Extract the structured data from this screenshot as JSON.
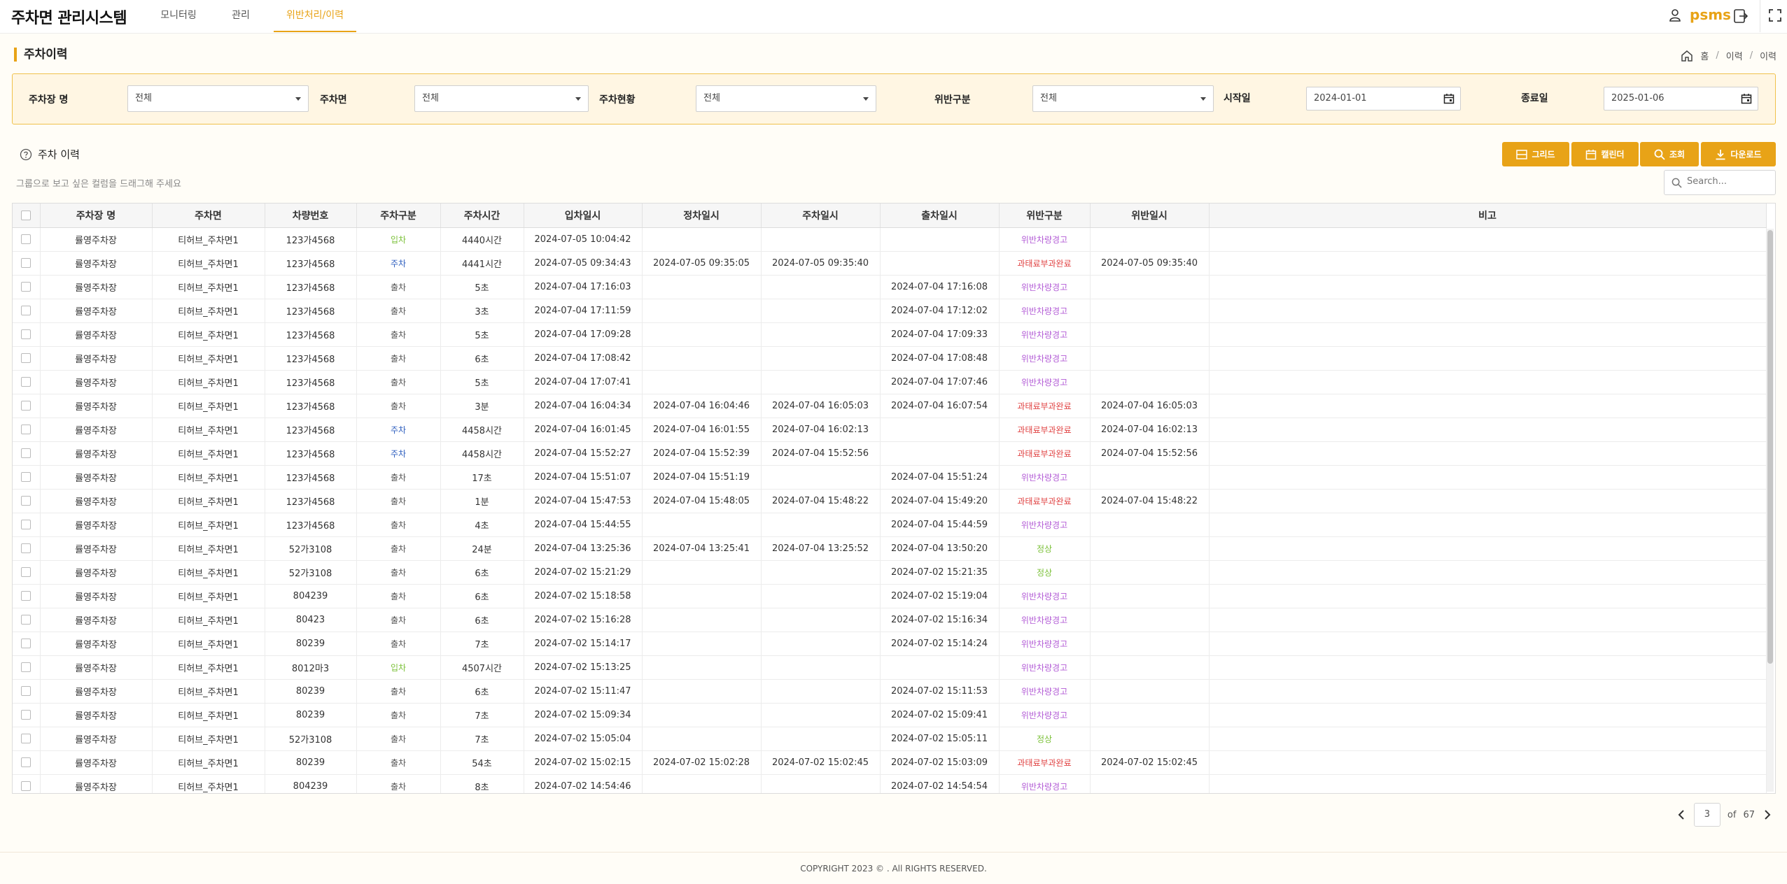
{
  "app": {
    "title": "주차면 관리시스템",
    "user": "psms"
  },
  "nav": {
    "tabs": [
      "모니터링",
      "관리",
      "위반처리/이력"
    ]
  },
  "page": {
    "title": "주차이력"
  },
  "breadcrumb": {
    "home": "홈",
    "level1": "이력",
    "level2": "이력"
  },
  "filters": {
    "lot_label": "주차장 명",
    "lot_value": "전체",
    "space_label": "주차면",
    "space_value": "전체",
    "status_label": "주차현황",
    "status_value": "전체",
    "violation_label": "위반구분",
    "violation_value": "전체",
    "start_label": "시작일",
    "start_value": "2024-01-01",
    "end_label": "종료일",
    "end_value": "2025-01-06"
  },
  "section": {
    "title": "주차 이력",
    "group_hint": "그룹으로 보고 싶은 컬럼을 드래그해 주세요"
  },
  "buttons": {
    "grid": "그리드",
    "calendar": "캘린더",
    "search": "조회",
    "download": "다운로드"
  },
  "search": {
    "placeholder": "Search..."
  },
  "colors": {
    "accent": "#e8a317",
    "entry": "#7cc13a",
    "parked": "#2f5fbf",
    "warning": "#b35cd6",
    "fine": "#e04141",
    "normal": "#7cc13a"
  },
  "table": {
    "columns": [
      "주차장 명",
      "주차면",
      "차량번호",
      "주차구분",
      "주차시간",
      "입차일시",
      "정차일시",
      "주차일시",
      "출차일시",
      "위반구분",
      "위반일시",
      "비고"
    ],
    "rows": [
      [
        "률영주차장",
        "티허브_주차면1",
        "123가4568",
        "입차",
        "4440시간",
        "2024-07-05 10:04:42",
        "",
        "",
        "",
        "위반차량경고",
        "",
        ""
      ],
      [
        "률영주차장",
        "티허브_주차면1",
        "123가4568",
        "주차",
        "4441시간",
        "2024-07-05 09:34:43",
        "2024-07-05 09:35:05",
        "2024-07-05 09:35:40",
        "",
        "과태료부과완료",
        "2024-07-05 09:35:40",
        ""
      ],
      [
        "률영주차장",
        "티허브_주차면1",
        "123가4568",
        "출차",
        "5초",
        "2024-07-04 17:16:03",
        "",
        "",
        "2024-07-04 17:16:08",
        "위반차량경고",
        "",
        ""
      ],
      [
        "률영주차장",
        "티허브_주차면1",
        "123가4568",
        "출차",
        "3초",
        "2024-07-04 17:11:59",
        "",
        "",
        "2024-07-04 17:12:02",
        "위반차량경고",
        "",
        ""
      ],
      [
        "률영주차장",
        "티허브_주차면1",
        "123가4568",
        "출차",
        "5초",
        "2024-07-04 17:09:28",
        "",
        "",
        "2024-07-04 17:09:33",
        "위반차량경고",
        "",
        ""
      ],
      [
        "률영주차장",
        "티허브_주차면1",
        "123가4568",
        "출차",
        "6초",
        "2024-07-04 17:08:42",
        "",
        "",
        "2024-07-04 17:08:48",
        "위반차량경고",
        "",
        ""
      ],
      [
        "률영주차장",
        "티허브_주차면1",
        "123가4568",
        "출차",
        "5초",
        "2024-07-04 17:07:41",
        "",
        "",
        "2024-07-04 17:07:46",
        "위반차량경고",
        "",
        ""
      ],
      [
        "률영주차장",
        "티허브_주차면1",
        "123가4568",
        "출차",
        "3분",
        "2024-07-04 16:04:34",
        "2024-07-04 16:04:46",
        "2024-07-04 16:05:03",
        "2024-07-04 16:07:54",
        "과태료부과완료",
        "2024-07-04 16:05:03",
        ""
      ],
      [
        "률영주차장",
        "티허브_주차면1",
        "123가4568",
        "주차",
        "4458시간",
        "2024-07-04 16:01:45",
        "2024-07-04 16:01:55",
        "2024-07-04 16:02:13",
        "",
        "과태료부과완료",
        "2024-07-04 16:02:13",
        ""
      ],
      [
        "률영주차장",
        "티허브_주차면1",
        "123가4568",
        "주차",
        "4458시간",
        "2024-07-04 15:52:27",
        "2024-07-04 15:52:39",
        "2024-07-04 15:52:56",
        "",
        "과태료부과완료",
        "2024-07-04 15:52:56",
        ""
      ],
      [
        "률영주차장",
        "티허브_주차면1",
        "123가4568",
        "출차",
        "17초",
        "2024-07-04 15:51:07",
        "2024-07-04 15:51:19",
        "",
        "2024-07-04 15:51:24",
        "위반차량경고",
        "",
        ""
      ],
      [
        "률영주차장",
        "티허브_주차면1",
        "123가4568",
        "출차",
        "1분",
        "2024-07-04 15:47:53",
        "2024-07-04 15:48:05",
        "2024-07-04 15:48:22",
        "2024-07-04 15:49:20",
        "과태료부과완료",
        "2024-07-04 15:48:22",
        ""
      ],
      [
        "률영주차장",
        "티허브_주차면1",
        "123가4568",
        "출차",
        "4초",
        "2024-07-04 15:44:55",
        "",
        "",
        "2024-07-04 15:44:59",
        "위반차량경고",
        "",
        ""
      ],
      [
        "률영주차장",
        "티허브_주차면1",
        "52가3108",
        "출차",
        "24분",
        "2024-07-04 13:25:36",
        "2024-07-04 13:25:41",
        "2024-07-04 13:25:52",
        "2024-07-04 13:50:20",
        "정상",
        "",
        ""
      ],
      [
        "률영주차장",
        "티허브_주차면1",
        "52가3108",
        "출차",
        "6초",
        "2024-07-02 15:21:29",
        "",
        "",
        "2024-07-02 15:21:35",
        "정상",
        "",
        ""
      ],
      [
        "률영주차장",
        "티허브_주차면1",
        "804239",
        "출차",
        "6초",
        "2024-07-02 15:18:58",
        "",
        "",
        "2024-07-02 15:19:04",
        "위반차량경고",
        "",
        ""
      ],
      [
        "률영주차장",
        "티허브_주차면1",
        "80423",
        "출차",
        "6초",
        "2024-07-02 15:16:28",
        "",
        "",
        "2024-07-02 15:16:34",
        "위반차량경고",
        "",
        ""
      ],
      [
        "률영주차장",
        "티허브_주차면1",
        "80239",
        "출차",
        "7초",
        "2024-07-02 15:14:17",
        "",
        "",
        "2024-07-02 15:14:24",
        "위반차량경고",
        "",
        ""
      ],
      [
        "률영주차장",
        "티허브_주차면1",
        "8012마3",
        "입차",
        "4507시간",
        "2024-07-02 15:13:25",
        "",
        "",
        "",
        "위반차량경고",
        "",
        ""
      ],
      [
        "률영주차장",
        "티허브_주차면1",
        "80239",
        "출차",
        "6초",
        "2024-07-02 15:11:47",
        "",
        "",
        "2024-07-02 15:11:53",
        "위반차량경고",
        "",
        ""
      ],
      [
        "률영주차장",
        "티허브_주차면1",
        "80239",
        "출차",
        "7초",
        "2024-07-02 15:09:34",
        "",
        "",
        "2024-07-02 15:09:41",
        "위반차량경고",
        "",
        ""
      ],
      [
        "률영주차장",
        "티허브_주차면1",
        "52가3108",
        "출차",
        "7초",
        "2024-07-02 15:05:04",
        "",
        "",
        "2024-07-02 15:05:11",
        "정상",
        "",
        ""
      ],
      [
        "률영주차장",
        "티허브_주차면1",
        "80239",
        "출차",
        "54초",
        "2024-07-02 15:02:15",
        "2024-07-02 15:02:28",
        "2024-07-02 15:02:45",
        "2024-07-02 15:03:09",
        "과태료부과완료",
        "2024-07-02 15:02:45",
        ""
      ],
      [
        "률영주차장",
        "티허브_주차면1",
        "804239",
        "출차",
        "8초",
        "2024-07-02 14:54:46",
        "",
        "",
        "2024-07-02 14:54:54",
        "위반차량경고",
        "",
        ""
      ]
    ]
  },
  "pagination": {
    "current": "3",
    "of_label": "of",
    "total": "67"
  },
  "footer": {
    "text": "COPYRIGHT 2023 © . All RIGHTS RESERVED."
  }
}
